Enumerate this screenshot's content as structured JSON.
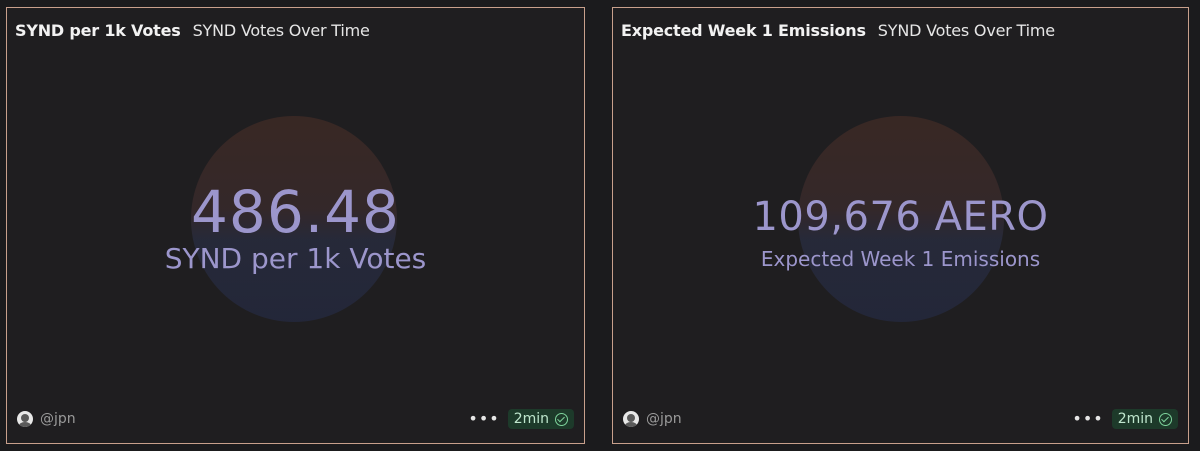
{
  "cards": [
    {
      "title": "SYND per 1k Votes",
      "tab": "SYND Votes Over Time",
      "value": "486.48",
      "label": "SYND per 1k Votes",
      "author": "@jpn",
      "more": "•••",
      "refresh": "2min"
    },
    {
      "title": "Expected Week 1 Emissions",
      "tab": "SYND Votes Over Time",
      "value": "109,676 AERO",
      "label": "Expected Week 1 Emissions",
      "author": "@jpn",
      "more": "•••",
      "refresh": "2min"
    }
  ],
  "colors": {
    "card_border": "#c8a08c",
    "counter_text": "#9c96cc",
    "badge_bg": "#1d3a2a",
    "badge_check": "#7ed39c"
  }
}
